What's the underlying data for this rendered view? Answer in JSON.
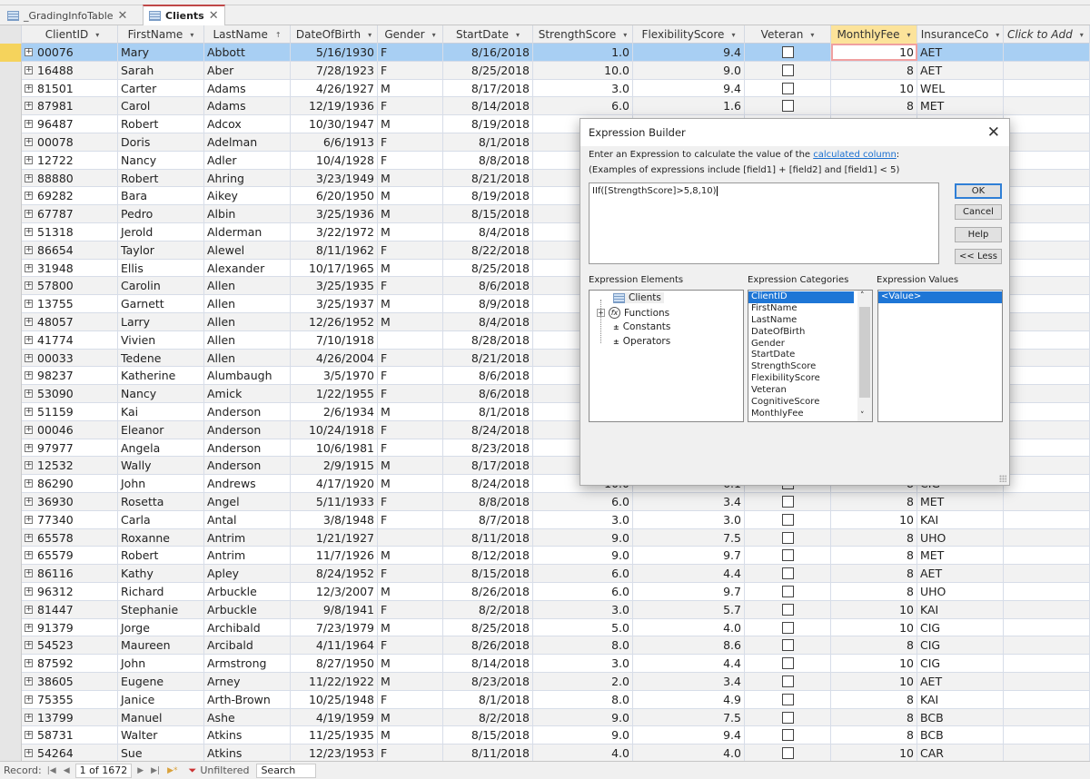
{
  "tabs": [
    {
      "label": "_GradingInfoTable",
      "active": false
    },
    {
      "label": "Clients",
      "active": true
    }
  ],
  "columns": [
    "ClientID",
    "FirstName",
    "LastName",
    "DateOfBirth",
    "Gender",
    "StartDate",
    "StrengthScore",
    "FlexibilityScore",
    "Veteran",
    "MonthlyFee",
    "InsuranceCo",
    "Click to Add"
  ],
  "rows": [
    [
      "00076",
      "Mary",
      "Abbott",
      "5/16/1930",
      "F",
      "8/16/2018",
      "1.0",
      "9.4",
      false,
      "10",
      "AET"
    ],
    [
      "16488",
      "Sarah",
      "Aber",
      "7/28/1923",
      "F",
      "8/25/2018",
      "10.0",
      "9.0",
      false,
      "8",
      "AET"
    ],
    [
      "81501",
      "Carter",
      "Adams",
      "4/26/1927",
      "M",
      "8/17/2018",
      "3.0",
      "9.4",
      false,
      "10",
      "WEL"
    ],
    [
      "87981",
      "Carol",
      "Adams",
      "12/19/1936",
      "F",
      "8/14/2018",
      "6.0",
      "1.6",
      false,
      "8",
      "MET"
    ],
    [
      "96487",
      "Robert",
      "Adcox",
      "10/30/1947",
      "M",
      "8/19/2018"
    ],
    [
      "00078",
      "Doris",
      "Adelman",
      "6/6/1913",
      "F",
      "8/1/2018"
    ],
    [
      "12722",
      "Nancy",
      "Adler",
      "10/4/1928",
      "F",
      "8/8/2018"
    ],
    [
      "88880",
      "Robert",
      "Ahring",
      "3/23/1949",
      "M",
      "8/21/2018"
    ],
    [
      "69282",
      "Bara",
      "Aikey",
      "6/20/1950",
      "M",
      "8/19/2018"
    ],
    [
      "67787",
      "Pedro",
      "Albin",
      "3/25/1936",
      "M",
      "8/15/2018"
    ],
    [
      "51318",
      "Jerold",
      "Alderman",
      "3/22/1972",
      "M",
      "8/4/2018"
    ],
    [
      "86654",
      "Taylor",
      "Alewel",
      "8/11/1962",
      "F",
      "8/22/2018"
    ],
    [
      "31948",
      "Ellis",
      "Alexander",
      "10/17/1965",
      "M",
      "8/25/2018"
    ],
    [
      "57800",
      "Carolin",
      "Allen",
      "3/25/1935",
      "F",
      "8/6/2018"
    ],
    [
      "13755",
      "Garnett",
      "Allen",
      "3/25/1937",
      "M",
      "8/9/2018"
    ],
    [
      "48057",
      "Larry",
      "Allen",
      "12/26/1952",
      "M",
      "8/4/2018"
    ],
    [
      "41774",
      "Vivien",
      "Allen",
      "7/10/1918",
      "",
      "8/28/2018"
    ],
    [
      "00033",
      "Tedene",
      "Allen",
      "4/26/2004",
      "F",
      "8/21/2018"
    ],
    [
      "98237",
      "Katherine",
      "Alumbaugh",
      "3/5/1970",
      "F",
      "8/6/2018"
    ],
    [
      "53090",
      "Nancy",
      "Amick",
      "1/22/1955",
      "F",
      "8/6/2018"
    ],
    [
      "51159",
      "Kai",
      "Anderson",
      "2/6/1934",
      "M",
      "8/1/2018"
    ],
    [
      "00046",
      "Eleanor",
      "Anderson",
      "10/24/1918",
      "F",
      "8/24/2018"
    ],
    [
      "97977",
      "Angela",
      "Anderson",
      "10/6/1981",
      "F",
      "8/23/2018"
    ],
    [
      "12532",
      "Wally",
      "Anderson",
      "2/9/1915",
      "M",
      "8/17/2018"
    ],
    [
      "86290",
      "John",
      "Andrews",
      "4/17/1920",
      "M",
      "8/24/2018",
      "10.0",
      "6.1",
      false,
      "8",
      "CIG"
    ],
    [
      "36930",
      "Rosetta",
      "Angel",
      "5/11/1933",
      "F",
      "8/8/2018",
      "6.0",
      "3.4",
      false,
      "8",
      "MET"
    ],
    [
      "77340",
      "Carla",
      "Antal",
      "3/8/1948",
      "F",
      "8/7/2018",
      "3.0",
      "3.0",
      false,
      "10",
      "KAI"
    ],
    [
      "65578",
      "Roxanne",
      "Antrim",
      "1/21/1927",
      "",
      "8/11/2018",
      "9.0",
      "7.5",
      false,
      "8",
      "UHO"
    ],
    [
      "65579",
      "Robert",
      "Antrim",
      "11/7/1926",
      "M",
      "8/12/2018",
      "9.0",
      "9.7",
      false,
      "8",
      "MET"
    ],
    [
      "86116",
      "Kathy",
      "Apley",
      "8/24/1952",
      "F",
      "8/15/2018",
      "6.0",
      "4.4",
      false,
      "8",
      "AET"
    ],
    [
      "96312",
      "Richard",
      "Arbuckle",
      "12/3/2007",
      "M",
      "8/26/2018",
      "6.0",
      "9.7",
      false,
      "8",
      "UHO"
    ],
    [
      "81447",
      "Stephanie",
      "Arbuckle",
      "9/8/1941",
      "F",
      "8/2/2018",
      "3.0",
      "5.7",
      false,
      "10",
      "KAI"
    ],
    [
      "91379",
      "Jorge",
      "Archibald",
      "7/23/1979",
      "M",
      "8/25/2018",
      "5.0",
      "4.0",
      false,
      "10",
      "CIG"
    ],
    [
      "54523",
      "Maureen",
      "Arcibald",
      "4/11/1964",
      "F",
      "8/26/2018",
      "8.0",
      "8.6",
      false,
      "8",
      "CIG"
    ],
    [
      "87592",
      "John",
      "Armstrong",
      "8/27/1950",
      "M",
      "8/14/2018",
      "3.0",
      "4.4",
      false,
      "10",
      "CIG"
    ],
    [
      "38605",
      "Eugene",
      "Arney",
      "11/22/1922",
      "M",
      "8/23/2018",
      "2.0",
      "3.4",
      false,
      "10",
      "AET"
    ],
    [
      "75355",
      "Janice",
      "Arth-Brown",
      "10/25/1948",
      "F",
      "8/1/2018",
      "8.0",
      "4.9",
      false,
      "8",
      "KAI"
    ],
    [
      "13799",
      "Manuel",
      "Ashe",
      "4/19/1959",
      "M",
      "8/2/2018",
      "9.0",
      "7.5",
      false,
      "8",
      "BCB"
    ],
    [
      "58731",
      "Walter",
      "Atkins",
      "11/25/1935",
      "M",
      "8/15/2018",
      "9.0",
      "9.4",
      false,
      "8",
      "BCB"
    ],
    [
      "54264",
      "Sue",
      "Atkins",
      "12/23/1953",
      "F",
      "8/11/2018",
      "4.0",
      "4.0",
      false,
      "10",
      "CAR"
    ]
  ],
  "status": {
    "record_label": "Record:",
    "position": "1 of 1672",
    "filter": "Unfiltered",
    "search": "Search"
  },
  "dialog": {
    "title": "Expression Builder",
    "instruction_prefix": "Enter an Expression to calculate the value of the ",
    "instruction_link": "calculated column",
    "instruction_suffix": ":",
    "examples": "(Examples of expressions include [field1] + [field2] and [field1] < 5)",
    "expression": "IIf([StrengthScore]>5,8,10)",
    "buttons": {
      "ok": "OK",
      "cancel": "Cancel",
      "help": "Help",
      "less": "<< Less"
    },
    "elements_label": "Expression Elements",
    "categories_label": "Expression Categories",
    "values_label": "Expression Values",
    "elements": [
      "Clients",
      "Functions",
      "Constants",
      "Operators"
    ],
    "categories": [
      "ClientID",
      "FirstName",
      "LastName",
      "DateOfBirth",
      "Gender",
      "StartDate",
      "StrengthScore",
      "FlexibilityScore",
      "Veteran",
      "CognitiveScore",
      "MonthlyFee"
    ],
    "values": [
      "<Value>"
    ]
  },
  "colors": {
    "selected_row": "#a8cff3",
    "active_column": "#fce39a",
    "link": "#1a6fd0",
    "highlight": "#1e76d6"
  }
}
